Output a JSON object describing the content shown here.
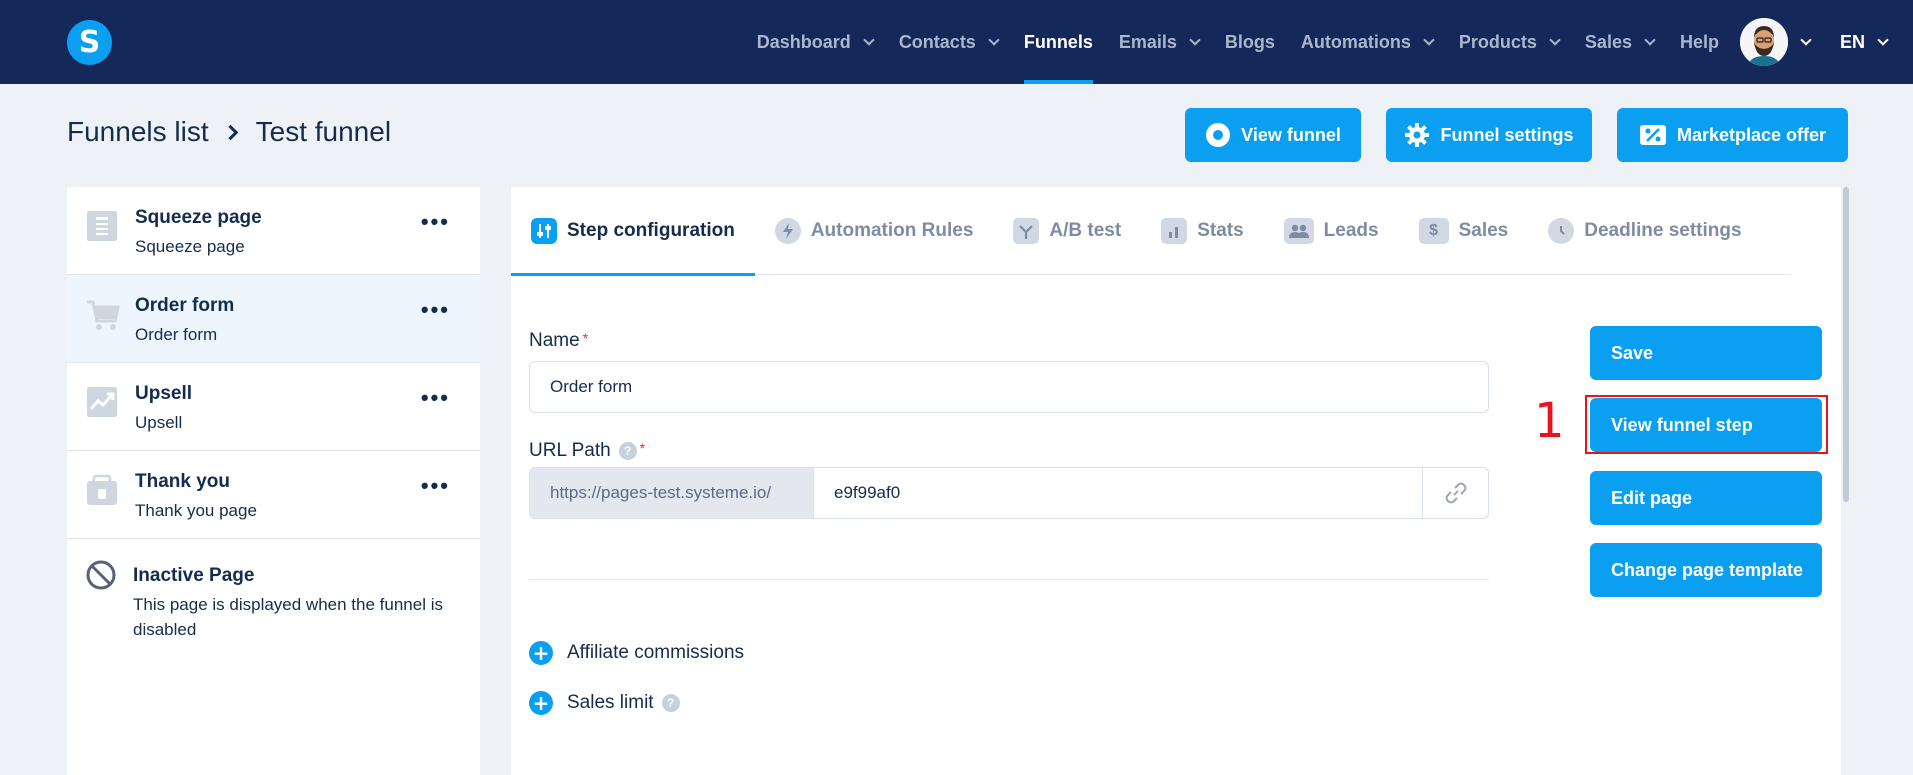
{
  "logo": {
    "letter": "S"
  },
  "nav": {
    "items": [
      {
        "label": "Dashboard",
        "dropdown": true,
        "active": false
      },
      {
        "label": "Contacts",
        "dropdown": true,
        "active": false
      },
      {
        "label": "Funnels",
        "dropdown": false,
        "active": true
      },
      {
        "label": "Emails",
        "dropdown": true,
        "active": false
      },
      {
        "label": "Blogs",
        "dropdown": false,
        "active": false
      },
      {
        "label": "Automations",
        "dropdown": true,
        "active": false
      },
      {
        "label": "Products",
        "dropdown": true,
        "active": false
      },
      {
        "label": "Sales",
        "dropdown": true,
        "active": false
      },
      {
        "label": "Help",
        "dropdown": false,
        "active": false
      }
    ],
    "language": "EN"
  },
  "breadcrumb": {
    "parent": "Funnels list",
    "current": "Test funnel"
  },
  "header_buttons": {
    "view_funnel": "View funnel",
    "funnel_settings": "Funnel settings",
    "marketplace_offer": "Marketplace offer"
  },
  "steps": [
    {
      "title": "Squeeze page",
      "subtitle": "Squeeze page",
      "icon": "squeeze-page-icon",
      "active": false
    },
    {
      "title": "Order form",
      "subtitle": "Order form",
      "icon": "cart-icon",
      "active": true
    },
    {
      "title": "Upsell",
      "subtitle": "Upsell",
      "icon": "upsell-chart-icon",
      "active": false
    },
    {
      "title": "Thank you",
      "subtitle": "Thank you page",
      "icon": "gift-icon",
      "active": false
    }
  ],
  "inactive_page": {
    "title": "Inactive Page",
    "description": "This page is displayed when the funnel is disabled"
  },
  "tabs": [
    {
      "label": "Step configuration",
      "icon": "sliders-icon",
      "active": true
    },
    {
      "label": "Automation Rules",
      "icon": "bolt-icon",
      "active": false
    },
    {
      "label": "A/B test",
      "icon": "split-icon",
      "active": false
    },
    {
      "label": "Stats",
      "icon": "bar-chart-icon",
      "active": false
    },
    {
      "label": "Leads",
      "icon": "users-icon",
      "active": false
    },
    {
      "label": "Sales",
      "icon": "dollar-icon",
      "active": false
    },
    {
      "label": "Deadline settings",
      "icon": "clock-icon",
      "active": false
    }
  ],
  "form": {
    "name_label": "Name",
    "name_value": "Order form",
    "url_label": "URL Path",
    "url_prefix": "https://pages-test.systeme.io/",
    "url_value": "e9f99af0",
    "required_mark": "*",
    "help_mark": "?"
  },
  "expanders": {
    "affiliate": "Affiliate commissions",
    "sales_limit": "Sales limit"
  },
  "actions": {
    "save": "Save",
    "view_step": "View funnel step",
    "edit_page": "Edit page",
    "change_template": "Change page template"
  },
  "annotation": {
    "marker": "1"
  },
  "colors": {
    "nav_bg": "#14295a",
    "accent": "#0a9ff0",
    "page_bg": "#eef2f7",
    "highlight": "#e8141b"
  }
}
